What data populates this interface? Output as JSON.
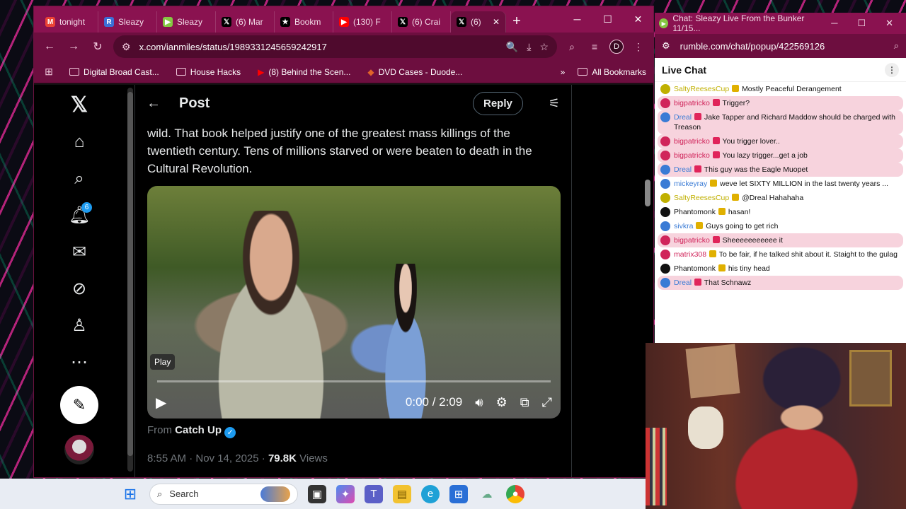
{
  "browser": {
    "tabs": [
      {
        "label": "tonight",
        "icon": "gmail-icon",
        "color": "#ea4335",
        "glyph": "M"
      },
      {
        "label": "Sleazy",
        "icon": "r-icon",
        "color": "#3b6fd6",
        "glyph": "R"
      },
      {
        "label": "Sleazy",
        "icon": "rumble-icon",
        "color": "#85c742",
        "glyph": "▶"
      },
      {
        "label": "(6) Mar",
        "icon": "x-icon",
        "color": "#000000",
        "glyph": "𝕏"
      },
      {
        "label": "Bookm",
        "icon": "star-icon",
        "color": "#000000",
        "glyph": "★"
      },
      {
        "label": "(130) F",
        "icon": "youtube-icon",
        "color": "#ff0000",
        "glyph": "▶"
      },
      {
        "label": "(6) Crai",
        "icon": "x-icon",
        "color": "#000000",
        "glyph": "𝕏"
      },
      {
        "label": "(6)",
        "icon": "x-icon",
        "color": "#000000",
        "glyph": "𝕏",
        "active": true
      }
    ],
    "url": "x.com/ianmiles/status/1989331245659242917",
    "profile_initial": "D",
    "bookmarks": [
      {
        "label": "Digital Broad Cast...",
        "type": "folder"
      },
      {
        "label": "House Hacks",
        "type": "folder"
      },
      {
        "label": "(8) Behind the Scen...",
        "type": "youtube"
      },
      {
        "label": "DVD Cases - Duode...",
        "type": "site"
      }
    ],
    "all_bookmarks": "All Bookmarks"
  },
  "xpage": {
    "notification_count": "6",
    "header_title": "Post",
    "reply_label": "Reply",
    "post_text": "wild. That book helped justify one of the greatest mass killings of the twentieth century. Tens of millions starved or were beaten to death in the Cultural Revolution.",
    "video": {
      "play_tooltip": "Play",
      "time": "0:00 / 2:09",
      "progress": 0
    },
    "from_prefix": "From",
    "from_name": "Catch Up",
    "timestamp": "8:55 AM · Nov 14, 2025 · ",
    "views_count": "79.8K",
    "views_label": " Views"
  },
  "chat": {
    "window_title": "Chat: Sleazy Live From the Bunker 11/15...",
    "url": "rumble.com/chat/popup/422569126",
    "heading": "Live Chat",
    "messages": [
      {
        "user": "SaltyReesesCup",
        "color": "#c0b000",
        "text": "Mostly Peaceful Derangement",
        "hl": false
      },
      {
        "user": "bigpatricko",
        "color": "#d0245a",
        "text": "Trigger?",
        "hl": true
      },
      {
        "user": "Dreal",
        "color": "#3a7bd5",
        "text": "Jake Tapper and Richard Maddow should be charged with Treason",
        "hl": true
      },
      {
        "user": "bigpatricko",
        "color": "#d0245a",
        "text": "You trigger lover..",
        "hl": true
      },
      {
        "user": "bigpatricko",
        "color": "#d0245a",
        "text": "You lazy trigger...get a job",
        "hl": true
      },
      {
        "user": "Dreal",
        "color": "#3a7bd5",
        "text": "This guy was the Eagle Muopet",
        "hl": true
      },
      {
        "user": "mickeyray",
        "color": "#3a7bd5",
        "text": "weve let SIXTY MILLION in the last twenty years ...",
        "hl": false
      },
      {
        "user": "SaltyReesesCup",
        "color": "#c0b000",
        "text": "@Dreal Hahahaha",
        "hl": false
      },
      {
        "user": "Phantomonk",
        "color": "#111111",
        "text": "hasan!",
        "hl": false
      },
      {
        "user": "sivkra",
        "color": "#3a7bd5",
        "text": "Guys going to get rich",
        "hl": false
      },
      {
        "user": "bigpatricko",
        "color": "#d0245a",
        "text": "Sheeeeeeeeeee it",
        "hl": true
      },
      {
        "user": "matrix308",
        "color": "#d0245a",
        "text": "To be fair, if he talked shit about it. Staight to the gulag",
        "hl": false
      },
      {
        "user": "Phantomonk",
        "color": "#111111",
        "text": "his tiny head",
        "hl": false
      },
      {
        "user": "Dreal",
        "color": "#3a7bd5",
        "text": "That Schnawz",
        "hl": true
      }
    ]
  },
  "taskbar": {
    "search_label": "Search"
  }
}
